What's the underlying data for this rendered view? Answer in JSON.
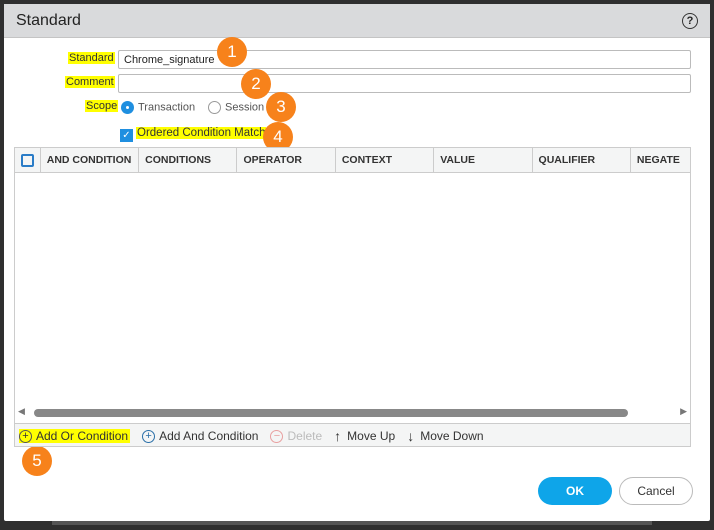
{
  "dialog": {
    "title": "Standard",
    "help_icon": "?"
  },
  "form": {
    "standard_label": "Standard",
    "standard_value": "Chrome_signature",
    "comment_label": "Comment",
    "comment_value": "",
    "scope_label": "Scope",
    "scope_options": [
      "Transaction",
      "Session"
    ],
    "scope_selected": "Transaction",
    "ordered_label": "Ordered Condition Match",
    "ordered_checked": true
  },
  "table": {
    "columns": [
      "AND CONDITION",
      "CONDITIONS",
      "OPERATOR",
      "CONTEXT",
      "VALUE",
      "QUALIFIER",
      "NEGATE"
    ],
    "rows": []
  },
  "toolbar": {
    "add_or": "Add Or Condition",
    "add_and": "Add And Condition",
    "delete": "Delete",
    "move_up": "Move Up",
    "move_down": "Move Down"
  },
  "footer": {
    "ok": "OK",
    "cancel": "Cancel"
  },
  "badges": [
    "1",
    "2",
    "3",
    "4",
    "5"
  ],
  "colors": {
    "accent": "#1f8fe0",
    "highlight": "#ffff00",
    "badge": "#f7821b",
    "ok_button": "#0ea5e9"
  }
}
